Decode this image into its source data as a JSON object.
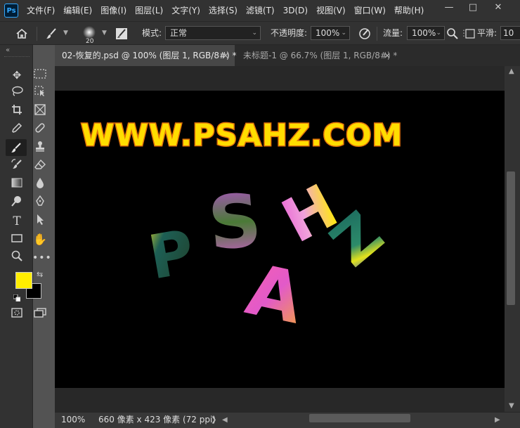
{
  "app": {
    "logo": "Ps"
  },
  "menu": [
    "文件(F)",
    "编辑(E)",
    "图像(I)",
    "图层(L)",
    "文字(Y)",
    "选择(S)",
    "滤镜(T)",
    "3D(D)",
    "视图(V)",
    "窗口(W)",
    "帮助(H)"
  ],
  "window": {
    "minimize": "—",
    "maximize": "□",
    "close": "✕"
  },
  "options": {
    "brush_size": "20",
    "mode_label": "模式:",
    "mode_value": "正常",
    "opacity_label": "不透明度:",
    "opacity_value": "100%",
    "flow_label": "流量:",
    "flow_value": "100%",
    "smoothing_label": "平滑:",
    "smoothing_value": "10"
  },
  "tabs": [
    {
      "label": "02-恢复的.psd @ 100% (图层 1, RGB/8#) *",
      "close": "×"
    },
    {
      "label": "未标题-1 @ 66.7% (图层 1, RGB/8#) *",
      "close": "×"
    }
  ],
  "canvas": {
    "website": "WWW.PSAHZ.COM",
    "letters": [
      "P",
      "S",
      "A",
      "H",
      "Z"
    ]
  },
  "status": {
    "zoom": "100%",
    "doc_info": "660 像素 x 423 像素 (72 ppi)",
    "arrow": "❯"
  },
  "colors": {
    "foreground": "#ffee00",
    "background": "#000000",
    "website_fill": "#ffdd00",
    "website_stroke": "#e0700a"
  },
  "icons": [
    "home-icon",
    "brush-icon",
    "move-icon",
    "marquee-icon",
    "lasso-icon",
    "crop-icon",
    "eyedropper-icon",
    "healing-icon",
    "stamp-icon",
    "eraser-icon",
    "gradient-icon",
    "dodge-icon",
    "pen-icon",
    "type-icon",
    "hand-icon",
    "zoom-icon"
  ]
}
